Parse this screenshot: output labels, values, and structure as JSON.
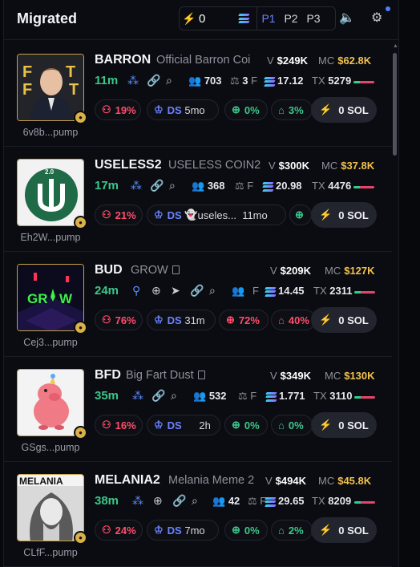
{
  "header": {
    "title": "Migrated",
    "quick_buy_amount": "0",
    "presets": [
      "P1",
      "P2",
      "P3"
    ],
    "active_preset": "P1"
  },
  "tokens": [
    {
      "ticker": "BARRON",
      "name": "Official Barron Coi",
      "address": "6v8b...pump",
      "volume": "$249K",
      "mcap": "$62.8K",
      "age": "11m",
      "holders": "703",
      "f_count": "3",
      "liquidity": "17.12",
      "tx": "5279",
      "pct1": "19%",
      "ds_extra": "5mo",
      "pct2": "0%",
      "pct3": "3%",
      "buy": "0 SOL",
      "social_icons": [
        "holders-icon",
        "link-icon",
        "search-icon"
      ]
    },
    {
      "ticker": "USELESS2",
      "name": "USELESS COIN2",
      "address": "Eh2W...pump",
      "volume": "$300K",
      "mcap": "$37.8K",
      "age": "17m",
      "holders": "368",
      "f_count": "",
      "liquidity": "20.98",
      "tx": "4476",
      "pct1": "21%",
      "ds_extra": "useles...",
      "ds_time": "11mo",
      "pct2": "",
      "pct3": "",
      "buy": "0 SOL",
      "social_icons": [
        "holders-icon",
        "link-icon",
        "search-icon"
      ]
    },
    {
      "ticker": "BUD",
      "name": "GROW",
      "address": "Cej3...pump",
      "volume": "$209K",
      "mcap": "$127K",
      "age": "24m",
      "holders": "",
      "f_count": "",
      "liquidity": "14.45",
      "tx": "2311",
      "pct1": "76%",
      "ds_extra": "31m",
      "pct2": "72%",
      "pct3": "40%",
      "buy": "0 SOL",
      "social_icons": [
        "user-icon",
        "globe-icon",
        "telegram-icon",
        "link-icon",
        "search-icon"
      ]
    },
    {
      "ticker": "BFD",
      "name": "Big Fart Dust",
      "address": "GSgs...pump",
      "volume": "$349K",
      "mcap": "$130K",
      "age": "35m",
      "holders": "532",
      "f_count": "",
      "liquidity": "1.771",
      "tx": "3110",
      "pct1": "16%",
      "ds_extra": "2h",
      "pct2": "0%",
      "pct3": "0%",
      "buy": "0 SOL",
      "social_icons": [
        "holders-icon",
        "link-icon",
        "search-icon"
      ]
    },
    {
      "ticker": "MELANIA2",
      "name": "Melania Meme 2",
      "address": "CLfF...pump",
      "volume": "$494K",
      "mcap": "$45.8K",
      "age": "38m",
      "holders": "42",
      "f_count": "",
      "liquidity": "29.65",
      "tx": "8209",
      "pct1": "24%",
      "ds_extra": "7mo",
      "pct2": "0%",
      "pct3": "2%",
      "buy": "0 SOL",
      "social_icons": [
        "holders-icon",
        "globe-icon",
        "link-icon",
        "search-icon"
      ]
    }
  ],
  "labels": {
    "v": "V",
    "mc": "MC",
    "tx": "TX",
    "f": "F",
    "ds": "DS"
  },
  "colors": {
    "green": "#3cc68a",
    "red": "#ff4d6a",
    "gold": "#f2c14e",
    "blue": "#5b8dff"
  }
}
